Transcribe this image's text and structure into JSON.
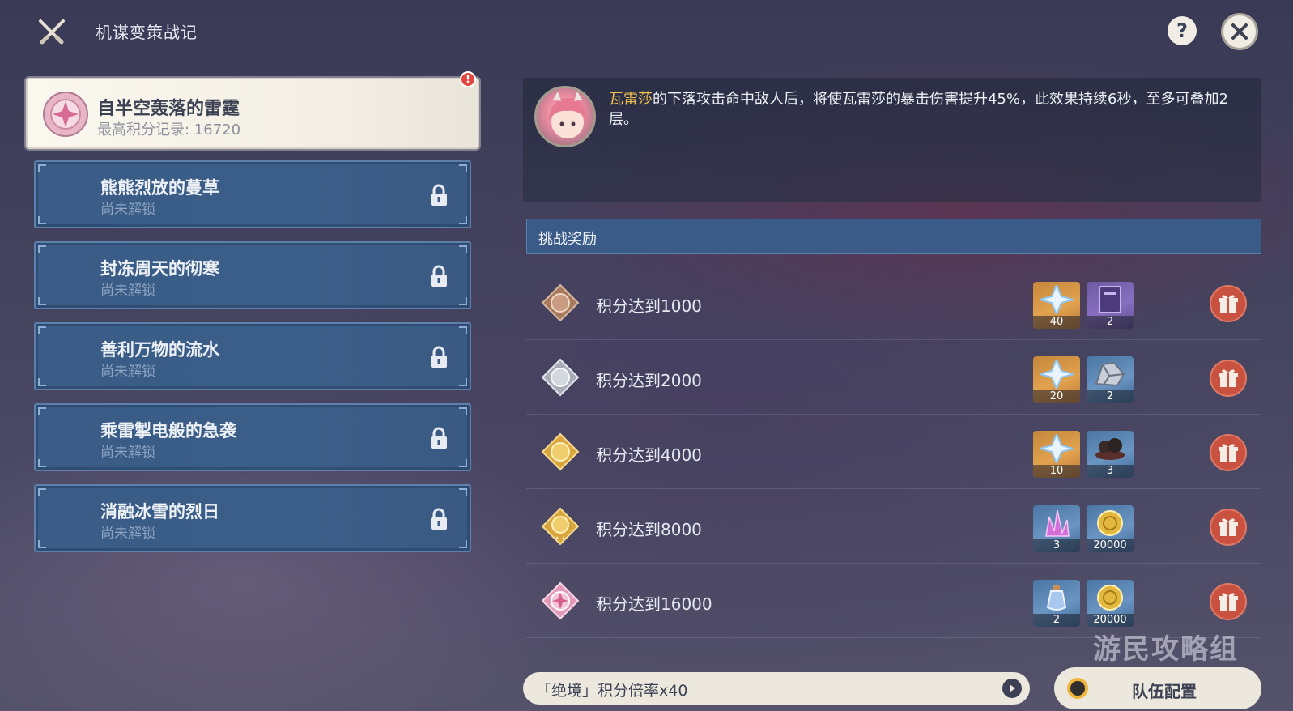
{
  "header": {
    "title": "机谋变策战记",
    "help_label": "?"
  },
  "stages": [
    {
      "name": "自半空轰落的雷霆",
      "status": "最高积分记录: 16720",
      "active": true,
      "alert": "!"
    },
    {
      "name": "熊熊烈放的蔓草",
      "status": "尚未解锁",
      "locked": true
    },
    {
      "name": "封冻周天的彻寒",
      "status": "尚未解锁",
      "locked": true
    },
    {
      "name": "善利万物的流水",
      "status": "尚未解锁",
      "locked": true
    },
    {
      "name": "乘雷掣电般的急袭",
      "status": "尚未解锁",
      "locked": true
    },
    {
      "name": "消融冰雪的烈日",
      "status": "尚未解锁",
      "locked": true
    }
  ],
  "buff": {
    "character": "瓦雷莎",
    "description": "的下落攻击命中敌人后，将使瓦雷莎的暴击伤害提升45%，此效果持续6秒，至多可叠加2层。"
  },
  "rewards": {
    "header": "挑战奖励",
    "tiers": [
      {
        "label": "积分达到1000",
        "medal": "bronze-medal-icon",
        "items": [
          {
            "icon": "primogem-icon",
            "qty": "40",
            "bg": "gold"
          },
          {
            "icon": "book-icon",
            "qty": "2",
            "bg": "purple"
          }
        ]
      },
      {
        "label": "积分达到2000",
        "medal": "silver-medal-icon",
        "items": [
          {
            "icon": "primogem-icon",
            "qty": "20",
            "bg": "gold"
          },
          {
            "icon": "ore-icon",
            "qty": "2",
            "bg": "blue"
          }
        ]
      },
      {
        "label": "积分达到4000",
        "medal": "gold-medal-icon",
        "items": [
          {
            "icon": "primogem-icon",
            "qty": "10",
            "bg": "gold"
          },
          {
            "icon": "material-icon",
            "qty": "3",
            "bg": "blue"
          }
        ]
      },
      {
        "label": "积分达到8000",
        "medal": "gold-star-medal-icon",
        "items": [
          {
            "icon": "crystal-icon",
            "qty": "3",
            "bg": "blue"
          },
          {
            "icon": "mora-icon",
            "qty": "20000",
            "bg": "blue"
          }
        ]
      },
      {
        "label": "积分达到16000",
        "medal": "pink-medal-icon",
        "items": [
          {
            "icon": "potion-icon",
            "qty": "2",
            "bg": "blue"
          },
          {
            "icon": "mora-icon",
            "qty": "20000",
            "bg": "blue"
          }
        ]
      }
    ]
  },
  "bottom": {
    "multiplier": "「绝境」积分倍率x40",
    "team_button": "队伍配置"
  },
  "watermark": "游民攻略组",
  "colors": {
    "accent_gold": "#f0c24c",
    "claim_red": "#c9513f",
    "card_blue": "#3a5c86"
  }
}
